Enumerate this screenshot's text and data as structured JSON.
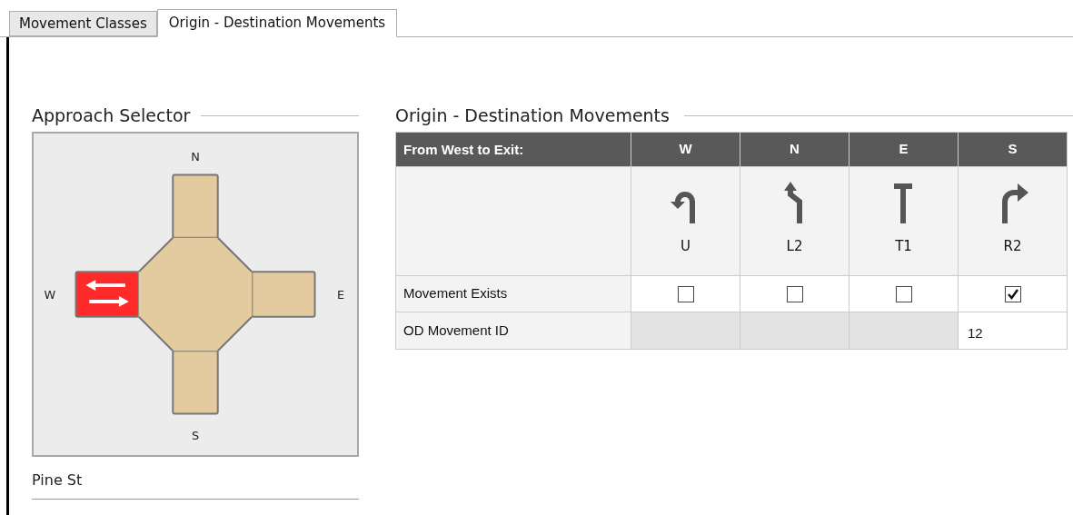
{
  "tabs": [
    {
      "label": "Movement Classes",
      "selected": false
    },
    {
      "label": "Origin - Destination Movements",
      "selected": true
    }
  ],
  "approach_selector": {
    "title": "Approach Selector",
    "approaches": [
      {
        "label": "W",
        "kind": "west",
        "selected": true
      },
      {
        "label": "N",
        "kind": "north",
        "selected": false
      },
      {
        "label": "E",
        "kind": "east",
        "selected": false
      },
      {
        "label": "S",
        "kind": "south",
        "selected": false
      }
    ],
    "street_name": "Pine St"
  },
  "od_movements": {
    "title": "Origin - Destination Movements",
    "header": "From West to Exit:",
    "row_labels": [
      "Movement Exists",
      "OD Movement ID"
    ],
    "columns": [
      {
        "exit": "W",
        "kind": "u-turn",
        "movement": "U",
        "exists": false
      },
      {
        "exit": "N",
        "kind": "left",
        "movement": "L2",
        "exists": false
      },
      {
        "exit": "E",
        "kind": "through",
        "movement": "T1",
        "exists": false
      },
      {
        "exit": "S",
        "kind": "right",
        "movement": "R2",
        "exists": true,
        "od_movement_id": "12"
      }
    ]
  }
}
